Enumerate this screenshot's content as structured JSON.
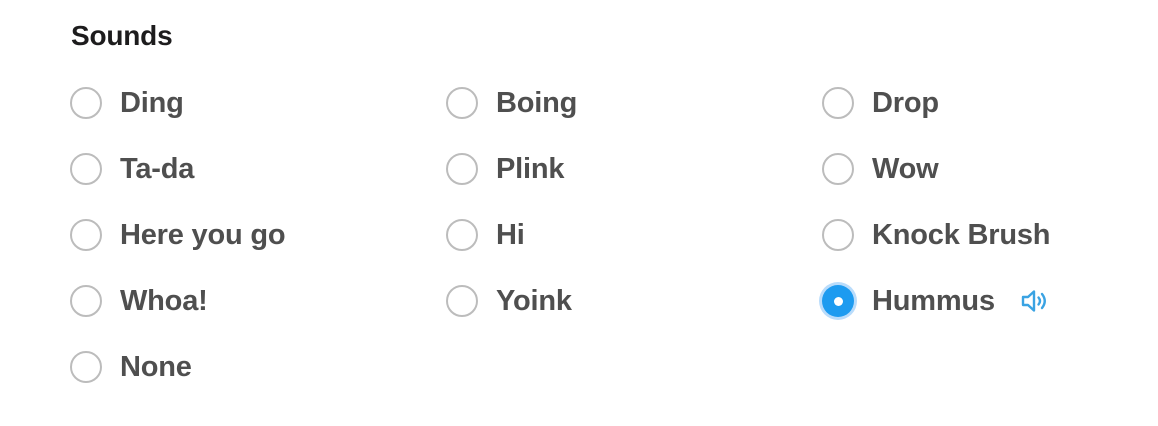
{
  "section": {
    "title": "Sounds"
  },
  "sounds": [
    {
      "label": "Ding",
      "selected": false
    },
    {
      "label": "Boing",
      "selected": false
    },
    {
      "label": "Drop",
      "selected": false
    },
    {
      "label": "Ta-da",
      "selected": false
    },
    {
      "label": "Plink",
      "selected": false
    },
    {
      "label": "Wow",
      "selected": false
    },
    {
      "label": "Here you go",
      "selected": false
    },
    {
      "label": "Hi",
      "selected": false
    },
    {
      "label": "Knock Brush",
      "selected": false
    },
    {
      "label": "Whoa!",
      "selected": false
    },
    {
      "label": "Yoink",
      "selected": false
    },
    {
      "label": "Hummus",
      "selected": true,
      "preview_icon": "speaker-icon"
    },
    {
      "label": "None",
      "selected": false
    }
  ],
  "colors": {
    "accent": "#1d9bf0",
    "speaker": "#3aa3e3",
    "label": "#4f4f4f",
    "heading": "#1d1c1d"
  }
}
